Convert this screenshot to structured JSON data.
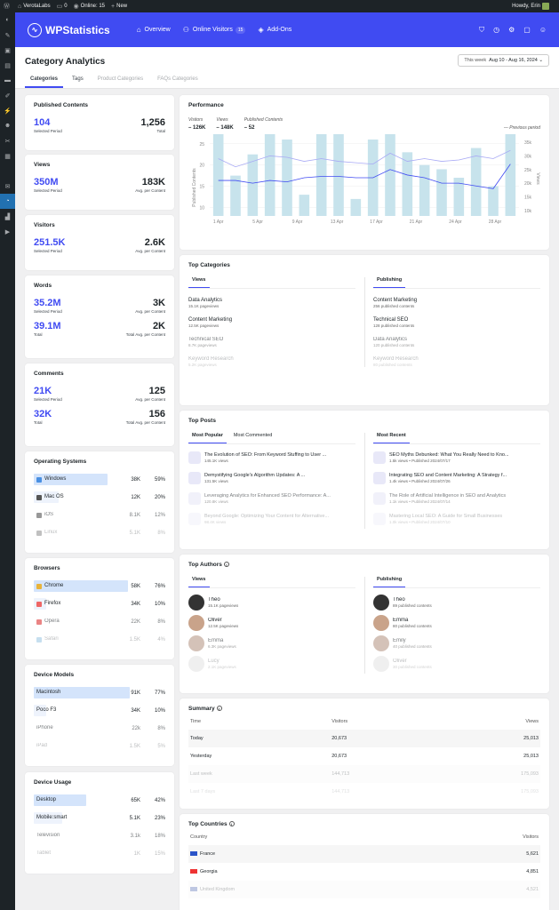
{
  "admin_bar": {
    "site": "VerotaLabs",
    "comments": "0",
    "online": "Online: 15",
    "new": "New",
    "howdy": "Howdy, Erin"
  },
  "nav": {
    "brand": "WPStatistics",
    "items": [
      {
        "label": "Overview"
      },
      {
        "label": "Online Visitors",
        "badge": "15"
      },
      {
        "label": "Add-Ons"
      }
    ]
  },
  "page": {
    "title": "Category Analytics",
    "date_label": "This week",
    "date_range": "Aug 10 - Aug 16, 2024 ⌄",
    "tabs": [
      "Categories",
      "Tags",
      "Product Categories",
      "FAQs Categories"
    ]
  },
  "published": {
    "title": "Published Contents",
    "left_value": "104",
    "left_label": "Selected Period",
    "right_value": "1,256",
    "right_label": "Total"
  },
  "views": {
    "title": "Views",
    "left_value": "350M",
    "left_label": "Selected Period",
    "right_value": "183K",
    "right_label": "Avg. per Content"
  },
  "visitors": {
    "title": "Visitors",
    "left_value": "251.5K",
    "left_label": "Selected Period",
    "right_value": "2.6K",
    "right_label": "Avg. per Content"
  },
  "words": {
    "title": "Words",
    "r1": {
      "left_value": "35.2M",
      "left_label": "Selected Period",
      "right_value": "3K",
      "right_label": "Avg. per Content"
    },
    "r2": {
      "left_value": "39.1M",
      "left_label": "Total",
      "right_value": "2K",
      "right_label": "Total Avg. per Content"
    }
  },
  "comments": {
    "title": "Comments",
    "r1": {
      "left_value": "21K",
      "left_label": "Selected Period",
      "right_value": "125",
      "right_label": "Avg. per Content"
    },
    "r2": {
      "left_value": "32K",
      "left_label": "Total",
      "right_value": "156",
      "right_label": "Total Avg. per Content"
    }
  },
  "os": {
    "title": "Operating Systems",
    "rows": [
      {
        "name": "Windows",
        "value": "38K",
        "pct": "59%",
        "share": 0.59,
        "icon_color": "#4a90e2"
      },
      {
        "name": "Mac OS",
        "value": "12K",
        "pct": "20%",
        "share": 0.2,
        "icon_color": "#555"
      },
      {
        "name": "iOS",
        "value": "8.1K",
        "pct": "12%",
        "share": 0.12,
        "icon_color": "#555"
      },
      {
        "name": "Linux",
        "value": "5.1K",
        "pct": "8%",
        "share": 0.08,
        "icon_color": "#333"
      }
    ]
  },
  "browsers": {
    "title": "Browsers",
    "rows": [
      {
        "name": "Chrome",
        "value": "58K",
        "pct": "76%",
        "share": 0.76,
        "icon_color": "#e8b33a"
      },
      {
        "name": "Firefox",
        "value": "34K",
        "pct": "10%",
        "share": 0.1,
        "icon_color": "#e66"
      },
      {
        "name": "Opera",
        "value": "22K",
        "pct": "8%",
        "share": 0.08,
        "icon_color": "#d33"
      },
      {
        "name": "Safari",
        "value": "1.5K",
        "pct": "4%",
        "share": 0.04,
        "icon_color": "#49c"
      }
    ]
  },
  "devices": {
    "title": "Device Models",
    "rows": [
      {
        "name": "Macintosh",
        "value": "91K",
        "pct": "77%",
        "share": 0.77
      },
      {
        "name": "Poco F3",
        "value": "34K",
        "pct": "10%",
        "share": 0.1
      },
      {
        "name": "iPhone",
        "value": "22k",
        "pct": "8%",
        "share": 0.08
      },
      {
        "name": "iPad",
        "value": "1.5K",
        "pct": "5%",
        "share": 0.05
      }
    ]
  },
  "usage": {
    "title": "Device Usage",
    "rows": [
      {
        "name": "Desktop",
        "value": "65K",
        "pct": "42%",
        "share": 0.42
      },
      {
        "name": "Mobile:smart",
        "value": "5.1K",
        "pct": "23%",
        "share": 0.23
      },
      {
        "name": "Television",
        "value": "3.1k",
        "pct": "18%",
        "share": 0.18
      },
      {
        "name": "Tablet",
        "value": "1K",
        "pct": "15%",
        "share": 0.15
      }
    ]
  },
  "performance": {
    "title": "Performance",
    "legend": [
      {
        "label": "Visitors",
        "value": "126K"
      },
      {
        "label": "Views",
        "value": "148K"
      },
      {
        "label": "Published Contents",
        "value": "52"
      }
    ],
    "prev": "Previous period",
    "ylabel_left": "Published Contents",
    "ylabel_right": "Views",
    "yticks_left": [
      "25",
      "20",
      "15",
      "10"
    ],
    "yticks_right": [
      "35k",
      "30k",
      "25k",
      "20k",
      "15k",
      "10k"
    ],
    "xticks": [
      "1 Apr",
      "5 Apr",
      "9 Apr",
      "13 Apr",
      "17 Apr",
      "21 Apr",
      "24 Apr",
      "28 Apr"
    ]
  },
  "chart_data": {
    "type": "bar",
    "title": "Performance",
    "ylabel": "Published Contents",
    "y2label": "Views",
    "ylim": [
      8,
      26
    ],
    "y2lim": [
      8000,
      36000
    ],
    "bars": [
      29.5,
      17.5,
      22.5,
      30.5,
      26,
      13,
      28,
      28,
      12,
      26,
      34,
      23,
      20,
      19,
      17,
      24,
      15,
      29
    ],
    "series": [
      {
        "name": "Visitors",
        "values": [
          21000,
          21000,
          20000,
          21000,
          20500,
          22000,
          22500,
          22500,
          22000,
          22000,
          25000,
          23000,
          22000,
          20000,
          20000,
          19000,
          18000,
          27000
        ]
      },
      {
        "name": "Views",
        "values": [
          29000,
          26000,
          28000,
          30000,
          29500,
          28000,
          29000,
          28000,
          27500,
          27000,
          31000,
          28000,
          29000,
          28000,
          28500,
          30000,
          29000,
          32000
        ]
      }
    ]
  },
  "top_categories": {
    "title": "Top Categories",
    "tab_views": "Views",
    "tab_pub": "Publishing",
    "views": [
      {
        "t": "Data Analytics",
        "s": "15.1K pageviews"
      },
      {
        "t": "Content Marketing",
        "s": "12.5K pageviews"
      },
      {
        "t": "Technical SEO",
        "s": "8.7K pageviews"
      },
      {
        "t": "Keyword Research",
        "s": "5.2K pageviews"
      }
    ],
    "pub": [
      {
        "t": "Content Marketing",
        "s": "256 published contents"
      },
      {
        "t": "Technical SEO",
        "s": "128 published contents"
      },
      {
        "t": "Data Analytics",
        "s": "120 published contents"
      },
      {
        "t": "Keyword Research",
        "s": "80 published contents"
      }
    ]
  },
  "top_posts": {
    "title": "Top Posts",
    "tabs": [
      "Most Popular",
      "Most Commented",
      "Most Recent"
    ],
    "popular": [
      {
        "t": "The Evolution of SEO: From Keyword Stuffing to User ...",
        "s": "145.1K views"
      },
      {
        "t": "Demystifying Google's Algorithm Updates: A ...",
        "s": "131.5K views"
      },
      {
        "t": "Leveraging Analytics for Enhanced SEO Performance: A...",
        "s": "120.8K views"
      },
      {
        "t": "Beyond Google: Optimizing Your Content for Alternative...",
        "s": "98.4K views"
      }
    ],
    "recent": [
      {
        "t": "SEO Myths Debunked: What You Really Need to Kno...",
        "s": "1.5k views  •  Published 2024/07/17"
      },
      {
        "t": "Integrating SEO and Content Marketing: A Strategy f...",
        "s": "1.4k views  •  Published 2024/07/26"
      },
      {
        "t": "The Role of Artificial Intelligence in SEO and Analytics",
        "s": "1.1k views  •  Published 2024/07/14"
      },
      {
        "t": "Mastering Local SEO: A Guide for Small Businesses",
        "s": "1.0k views  •  Published 2024/07/10"
      }
    ]
  },
  "top_authors": {
    "title": "Top Authors",
    "tab_views": "Views",
    "tab_pub": "Publishing",
    "views": [
      {
        "t": "Theo",
        "s": "15.1K pageviews"
      },
      {
        "t": "Oliver",
        "s": "12.5K pageviews"
      },
      {
        "t": "Emma",
        "s": "6.3K pageviews"
      },
      {
        "t": "Lucy",
        "s": "2.1K pageviews"
      }
    ],
    "pub": [
      {
        "t": "Theo",
        "s": "89 published contents"
      },
      {
        "t": "Emma",
        "s": "80 published contents"
      },
      {
        "t": "Emily",
        "s": "40 published contents"
      },
      {
        "t": "Oliver",
        "s": "30 published contents"
      }
    ]
  },
  "summary": {
    "title": "Summary",
    "headers": [
      "Time",
      "Visitors",
      "Views"
    ],
    "rows": [
      [
        "Today",
        "20,673",
        "25,013"
      ],
      [
        "Yesterday",
        "20,673",
        "25,013"
      ],
      [
        "Last week",
        "144,713",
        "175,093"
      ],
      [
        "Last 7 days",
        "144,713",
        "175,093"
      ]
    ]
  },
  "countries": {
    "title": "Top Countries",
    "headers": [
      "Country",
      "Visitors"
    ],
    "rows": [
      [
        "France",
        "5,621",
        "#2b54c8"
      ],
      [
        "Georgia",
        "4,851",
        "#e33"
      ],
      [
        "United Kingdom",
        "4,521",
        "#2b4aa0"
      ]
    ]
  }
}
